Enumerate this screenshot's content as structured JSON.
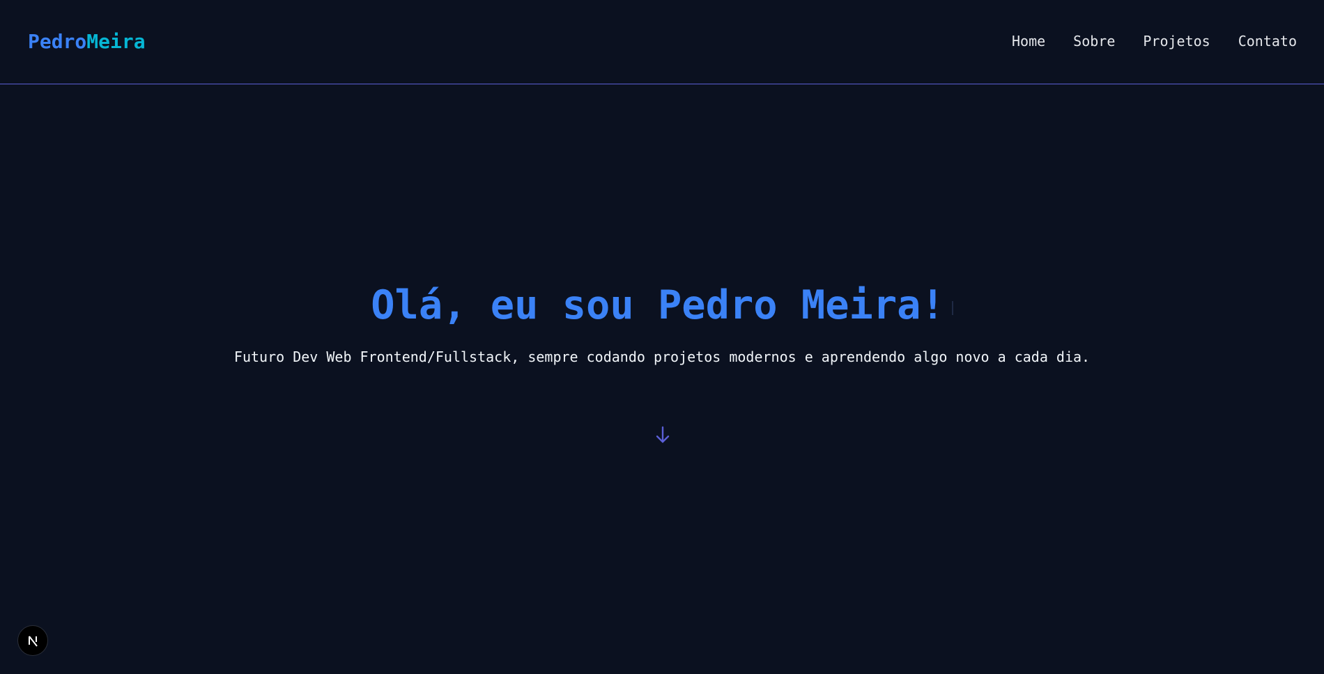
{
  "header": {
    "brand_first": "Pedro",
    "brand_last": "Meira",
    "nav": [
      {
        "label": "Home"
      },
      {
        "label": "Sobre"
      },
      {
        "label": "Projetos"
      },
      {
        "label": "Contato"
      }
    ]
  },
  "hero": {
    "title": "Olá, eu sou Pedro Meira!",
    "subtitle": "Futuro Dev Web Frontend/Fullstack, sempre codando projetos modernos e aprendendo algo novo a cada dia.",
    "scroll_icon": "arrow-down-icon"
  },
  "dev_indicator": {
    "icon": "nextjs-logo-icon",
    "glyph": "N"
  },
  "colors": {
    "background": "#0b1120",
    "accent_blue": "#3b82f6",
    "accent_cyan": "#06b6d4",
    "accent_indigo": "#5b5fd6",
    "text": "#f1f5f9"
  }
}
